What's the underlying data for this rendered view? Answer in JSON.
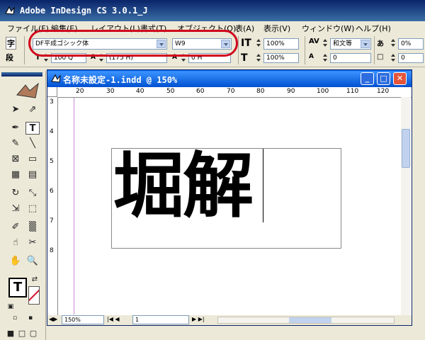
{
  "app": {
    "title": "Adobe InDesign CS 3.0.1_J"
  },
  "menu": [
    {
      "label": "ファイル(F)"
    },
    {
      "label": "編集(E)"
    },
    {
      "label": "レイアウト(L)"
    },
    {
      "label": "書式(T)"
    },
    {
      "label": "オブジェクト(O)"
    },
    {
      "label": "表(A)"
    },
    {
      "label": "表示(V)"
    },
    {
      "label": "ウィンドウ(W)"
    },
    {
      "label": "ヘルプ(H)"
    }
  ],
  "control_panel": {
    "char_mode_glyph": "字",
    "para_mode_glyph": "段",
    "font_family": "DF平成ゴシック体",
    "font_style": "W9",
    "font_size": "100 Q",
    "leading": "(175 H)",
    "tracking_value": "0 H",
    "vscale": "100%",
    "hscale": "100%",
    "kerning": "和文等",
    "tsume": "0%",
    "baseline": "0",
    "aki": "0"
  },
  "document": {
    "title": "名称未設定-1.indd @ 150%",
    "ruler_h": [
      "20",
      "30",
      "40",
      "50",
      "60",
      "70",
      "80",
      "90",
      "100",
      "110",
      "120"
    ],
    "ruler_v": [
      "3",
      "4",
      "5",
      "6",
      "7",
      "8"
    ],
    "content_text": "堀解",
    "zoom": "150%",
    "page_number": "1"
  },
  "colors": {
    "highlight": "#d0021b",
    "titlebar": "#0a246a",
    "doc_titlebar": "#0058e6"
  }
}
